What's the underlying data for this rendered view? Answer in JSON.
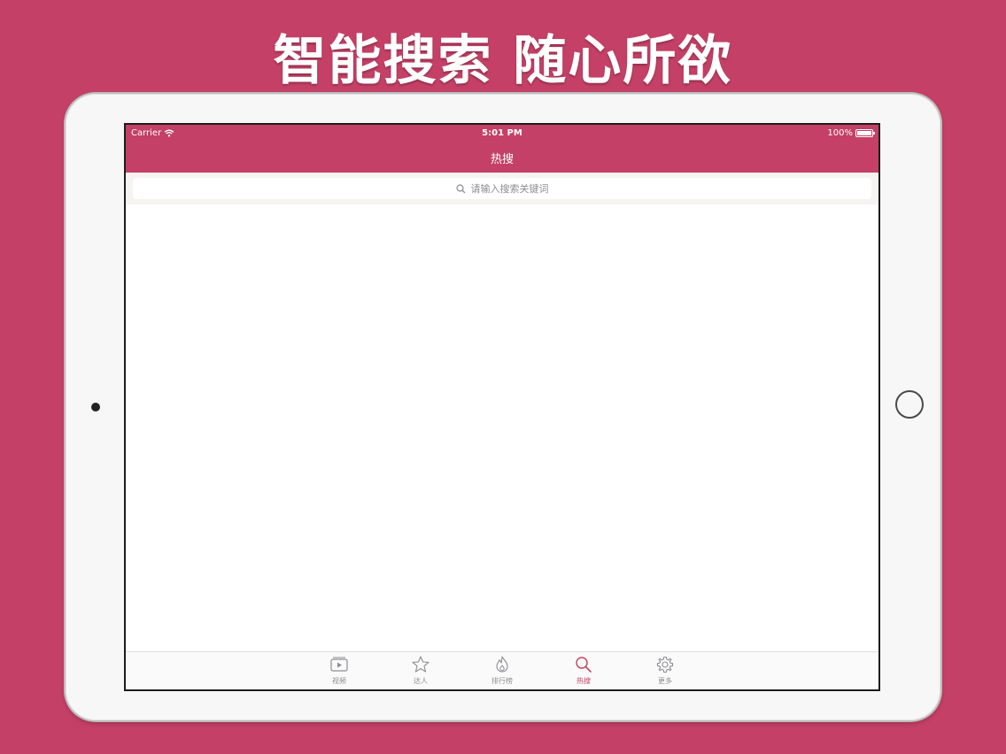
{
  "headline": "智能搜索 随心所欲",
  "colors": {
    "brand": "#c44066",
    "tab_inactive": "#8e8e93",
    "background": "#c44066"
  },
  "status_bar": {
    "carrier": "Carrier",
    "time": "5:01 PM",
    "battery": "100%"
  },
  "navbar": {
    "title": "热搜"
  },
  "search": {
    "placeholder": "请输入搜索关键词",
    "icon": "search-icon"
  },
  "tabbar": {
    "items": [
      {
        "label": "视频",
        "icon": "video-icon",
        "active": false
      },
      {
        "label": "达人",
        "icon": "star-icon",
        "active": false
      },
      {
        "label": "排行榜",
        "icon": "flame-icon",
        "active": false
      },
      {
        "label": "热搜",
        "icon": "search-icon",
        "active": true
      },
      {
        "label": "更多",
        "icon": "gear-icon",
        "active": false
      }
    ]
  }
}
